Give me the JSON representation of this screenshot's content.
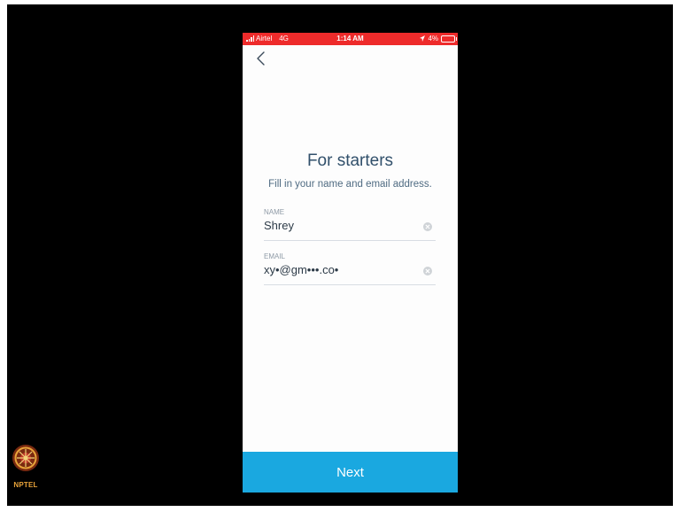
{
  "status_bar": {
    "carrier": "Airtel",
    "network": "4G",
    "time": "1:14 AM",
    "battery": "4%",
    "color": "#ee2b2b"
  },
  "screen": {
    "title": "For starters",
    "subtitle": "Fill in your name and email address."
  },
  "form": {
    "name": {
      "label": "NAME",
      "value": "Shrey"
    },
    "email": {
      "label": "EMAIL",
      "value": "xy•@gm•••.co•"
    }
  },
  "actions": {
    "next_label": "Next",
    "accent_color": "#1aa8e0"
  },
  "watermark": {
    "logo_text": "NPTEL"
  },
  "icons": {
    "back": "chevron-left-icon",
    "clear": "clear-circle-icon",
    "signal": "signal-bars-icon",
    "location": "location-arrow-icon",
    "battery": "battery-icon"
  }
}
